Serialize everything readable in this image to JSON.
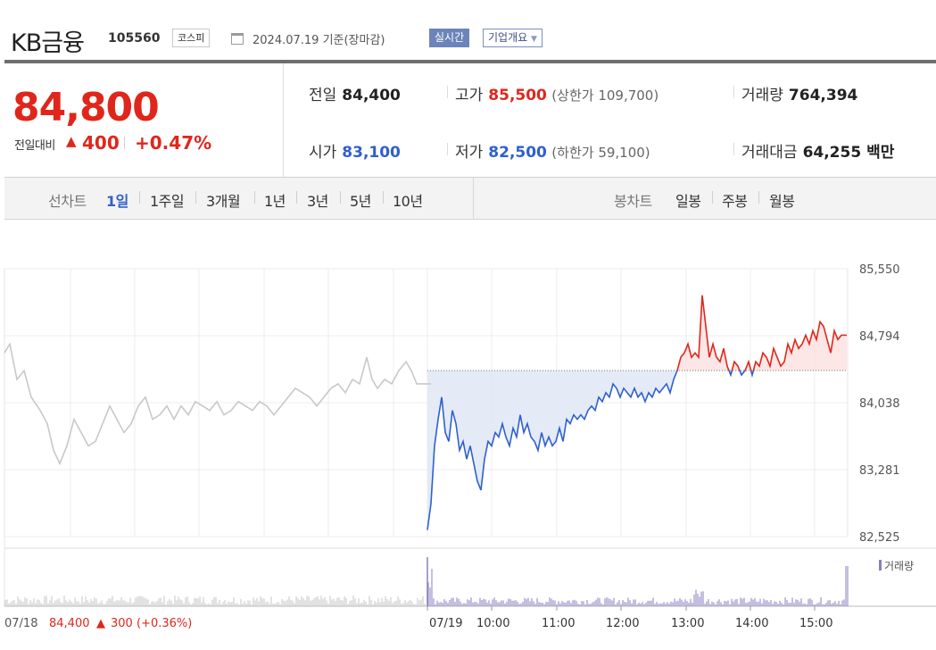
{
  "header": {
    "stock_name": "KB금융",
    "stock_code": "105560",
    "market": "코스피",
    "date": "2024.07.19 기준(장마감)",
    "realtime_label": "실시간",
    "company_info_label": "기업개요"
  },
  "quote": {
    "price": "84,800",
    "change_label": "전일대비",
    "change_arrow": "▲",
    "change_value": "400",
    "change_percent": "+0.47%",
    "prev_close_label": "전일",
    "prev_close": "84,400",
    "high_label": "고가",
    "high": "85,500",
    "upper_limit": "(상한가 109,700)",
    "volume_label": "거래량",
    "volume": "764,394",
    "open_label": "시가",
    "open": "83,100",
    "low_label": "저가",
    "low": "82,500",
    "lower_limit": "(하한가 59,100)",
    "amount_label": "거래대금",
    "amount": "64,255 백만"
  },
  "period_tabs": {
    "label": "선차트",
    "items": [
      "1일",
      "1주일",
      "3개월",
      "1년",
      "3년",
      "5년",
      "10년"
    ],
    "selected": "1일"
  },
  "candle_tabs": {
    "label": "봉차트",
    "items": [
      "일봉",
      "주봉",
      "월봉"
    ]
  },
  "colors": {
    "up": "#e0261b",
    "down": "#2f5fcf",
    "prev_day_line": "#c8c8c8",
    "volume": "#8a7fc0"
  },
  "chart_data": {
    "type": "line",
    "y_ticks": [
      "85,550",
      "84,794",
      "84,038",
      "83,281",
      "82,525"
    ],
    "ylim": [
      82525,
      85550
    ],
    "x_ticks": [
      "07/19",
      "10:00",
      "11:00",
      "12:00",
      "13:00",
      "14:00",
      "15:00"
    ],
    "reference_price": 84400,
    "series": [
      {
        "key": "prev_day",
        "points": [
          [
            0,
            84600
          ],
          [
            6,
            84700
          ],
          [
            14,
            84300
          ],
          [
            22,
            84400
          ],
          [
            30,
            84100
          ],
          [
            40,
            83950
          ],
          [
            48,
            83800
          ],
          [
            55,
            83500
          ],
          [
            62,
            83350
          ],
          [
            70,
            83550
          ],
          [
            78,
            83850
          ],
          [
            86,
            83700
          ],
          [
            94,
            83550
          ],
          [
            102,
            83600
          ],
          [
            110,
            83800
          ],
          [
            118,
            84000
          ],
          [
            126,
            83850
          ],
          [
            134,
            83700
          ],
          [
            142,
            83800
          ],
          [
            150,
            84000
          ],
          [
            158,
            84100
          ],
          [
            166,
            83850
          ],
          [
            174,
            83900
          ],
          [
            182,
            84000
          ],
          [
            190,
            83850
          ],
          [
            198,
            84000
          ],
          [
            206,
            83900
          ],
          [
            214,
            84050
          ],
          [
            222,
            84000
          ],
          [
            230,
            83950
          ],
          [
            238,
            84050
          ],
          [
            246,
            83900
          ],
          [
            254,
            83950
          ],
          [
            262,
            84050
          ],
          [
            270,
            84000
          ],
          [
            278,
            83950
          ],
          [
            286,
            84050
          ],
          [
            294,
            84000
          ],
          [
            302,
            83900
          ],
          [
            310,
            84000
          ],
          [
            318,
            84100
          ],
          [
            326,
            84200
          ],
          [
            334,
            84150
          ],
          [
            342,
            84100
          ],
          [
            350,
            84000
          ],
          [
            358,
            84100
          ],
          [
            366,
            84200
          ],
          [
            374,
            84250
          ],
          [
            382,
            84150
          ],
          [
            390,
            84300
          ],
          [
            398,
            84250
          ],
          [
            406,
            84550
          ],
          [
            412,
            84300
          ],
          [
            418,
            84200
          ],
          [
            426,
            84300
          ],
          [
            434,
            84250
          ],
          [
            442,
            84400
          ],
          [
            450,
            84500
          ],
          [
            456,
            84400
          ],
          [
            462,
            84250
          ],
          [
            470,
            84250
          ],
          [
            478,
            84250
          ]
        ]
      },
      {
        "key": "today",
        "points": [
          [
            0,
            82600
          ],
          [
            4,
            82900
          ],
          [
            8,
            83550
          ],
          [
            12,
            83850
          ],
          [
            16,
            84100
          ],
          [
            20,
            83700
          ],
          [
            24,
            83600
          ],
          [
            28,
            83950
          ],
          [
            32,
            83800
          ],
          [
            36,
            83500
          ],
          [
            40,
            83600
          ],
          [
            44,
            83400
          ],
          [
            48,
            83550
          ],
          [
            52,
            83350
          ],
          [
            56,
            83150
          ],
          [
            60,
            83050
          ],
          [
            64,
            83400
          ],
          [
            68,
            83600
          ],
          [
            72,
            83550
          ],
          [
            76,
            83700
          ],
          [
            80,
            83650
          ],
          [
            84,
            83800
          ],
          [
            88,
            83650
          ],
          [
            92,
            83550
          ],
          [
            96,
            83750
          ],
          [
            100,
            83650
          ],
          [
            104,
            83900
          ],
          [
            108,
            83700
          ],
          [
            112,
            83800
          ],
          [
            116,
            83650
          ],
          [
            120,
            83600
          ],
          [
            124,
            83500
          ],
          [
            128,
            83700
          ],
          [
            132,
            83550
          ],
          [
            136,
            83650
          ],
          [
            140,
            83550
          ],
          [
            144,
            83600
          ],
          [
            148,
            83750
          ],
          [
            152,
            83600
          ],
          [
            156,
            83850
          ],
          [
            160,
            83800
          ],
          [
            164,
            83900
          ],
          [
            168,
            83850
          ],
          [
            172,
            83900
          ],
          [
            176,
            83850
          ],
          [
            180,
            83950
          ],
          [
            184,
            84000
          ],
          [
            188,
            83950
          ],
          [
            192,
            84100
          ],
          [
            196,
            84050
          ],
          [
            200,
            84150
          ],
          [
            204,
            84100
          ],
          [
            208,
            84250
          ],
          [
            212,
            84200
          ],
          [
            216,
            84100
          ],
          [
            220,
            84200
          ],
          [
            224,
            84150
          ],
          [
            228,
            84100
          ],
          [
            232,
            84200
          ],
          [
            236,
            84100
          ],
          [
            240,
            84150
          ],
          [
            244,
            84050
          ],
          [
            248,
            84150
          ],
          [
            252,
            84100
          ],
          [
            256,
            84200
          ],
          [
            260,
            84150
          ],
          [
            264,
            84200
          ],
          [
            268,
            84250
          ],
          [
            272,
            84150
          ],
          [
            276,
            84300
          ],
          [
            280,
            84400
          ],
          [
            284,
            84550
          ],
          [
            288,
            84600
          ],
          [
            292,
            84700
          ],
          [
            296,
            84550
          ],
          [
            300,
            84600
          ],
          [
            304,
            84550
          ],
          [
            308,
            85250
          ],
          [
            312,
            84900
          ],
          [
            316,
            84550
          ],
          [
            320,
            84700
          ],
          [
            324,
            84550
          ],
          [
            328,
            84500
          ],
          [
            332,
            84650
          ],
          [
            336,
            84450
          ],
          [
            340,
            84350
          ],
          [
            344,
            84500
          ],
          [
            348,
            84450
          ],
          [
            352,
            84350
          ],
          [
            356,
            84400
          ],
          [
            360,
            84500
          ],
          [
            364,
            84350
          ],
          [
            368,
            84500
          ],
          [
            372,
            84450
          ],
          [
            376,
            84600
          ],
          [
            380,
            84550
          ],
          [
            384,
            84450
          ],
          [
            388,
            84650
          ],
          [
            392,
            84550
          ],
          [
            396,
            84450
          ],
          [
            400,
            84500
          ],
          [
            404,
            84700
          ],
          [
            408,
            84600
          ],
          [
            412,
            84750
          ],
          [
            416,
            84650
          ],
          [
            420,
            84700
          ],
          [
            424,
            84800
          ],
          [
            428,
            84700
          ],
          [
            432,
            84850
          ],
          [
            436,
            84750
          ],
          [
            440,
            84950
          ],
          [
            444,
            84900
          ],
          [
            448,
            84750
          ],
          [
            452,
            84600
          ],
          [
            456,
            84850
          ],
          [
            460,
            84750
          ],
          [
            464,
            84800
          ],
          [
            470,
            84800
          ]
        ]
      }
    ],
    "volume_legend": "거래량",
    "volume_axis_labels": [
      "07/18",
      "07/19"
    ],
    "prev_summary": {
      "price": "84,400",
      "arrow": "▲",
      "change": "300",
      "percent": "(+0.36%)"
    }
  }
}
